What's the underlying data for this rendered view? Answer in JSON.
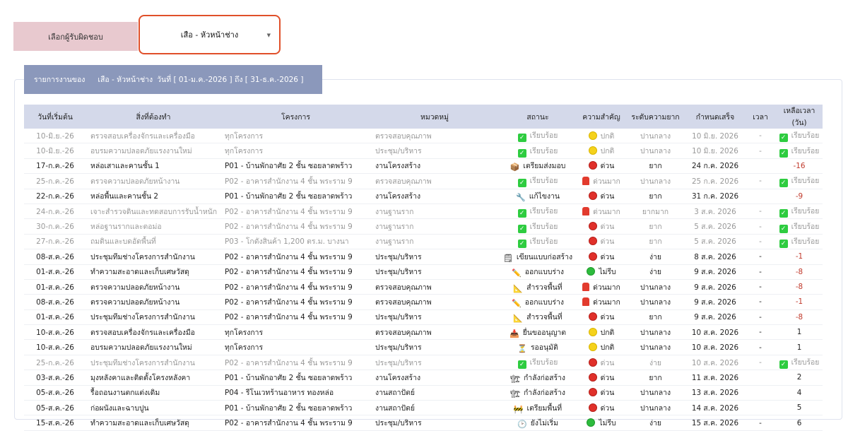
{
  "filter": {
    "label": "เลือกผู้รับผิดชอบ",
    "selected": "เสือ - หัวหน้าช่าง"
  },
  "report": {
    "prefix": "รายการงานของ",
    "person": "เสือ - หัวหน้าช่าง",
    "range": "วันที่ [ 01-ม.ค.-2026 ] ถึง [ 31-ธ.ค.-2026 ]"
  },
  "columns": [
    "วันที่เริ่มต้น",
    "สิ่งที่ต้องทำ",
    "โครงการ",
    "หมวดหมู่",
    "สถานะ",
    "ความสำคัญ",
    "ระดับความยาก",
    "กำหนดเสร็จ",
    "เวลา",
    "เหลือเวลา (วัน)"
  ],
  "rows": [
    {
      "done": true,
      "start": "10-มิ.ย.-26",
      "task": "ตรวจสอบเครื่องจักรและเครื่องมือ",
      "project": "ทุกโครงการ",
      "category": "ตรวจสอบคุณภาพ",
      "status_icon": "check",
      "status": "เรียบร้อย",
      "priority_icon": "dot-yellow",
      "priority": "ปกติ",
      "difficulty": "ปานกลาง",
      "due": "10 มิ.ย. 2026",
      "time": "-",
      "remain_icon": "check",
      "remain": "เรียบร้อย"
    },
    {
      "done": true,
      "start": "10-มิ.ย.-26",
      "task": "อบรมความปลอดภัยแรงงานใหม่",
      "project": "ทุกโครงการ",
      "category": "ประชุม/บริหาร",
      "status_icon": "check",
      "status": "เรียบร้อย",
      "priority_icon": "dot-yellow",
      "priority": "ปกติ",
      "difficulty": "ปานกลาง",
      "due": "10 มิ.ย. 2026",
      "time": "-",
      "remain_icon": "check",
      "remain": "เรียบร้อย"
    },
    {
      "done": false,
      "start": "17-ก.ค.-26",
      "task": "หล่อเสาและคานชั้น 1",
      "project": "P01 - บ้านพักอาศัย 2 ชั้น ซอยลาดพร้าว",
      "category": "งานโครงสร้าง",
      "status_icon": "box-icon",
      "status": "เตรียมส่งมอบ",
      "priority_icon": "dot-red",
      "priority": "ด่วน",
      "difficulty": "ยาก",
      "due": "24 ก.ค. 2026",
      "time": "",
      "remain_icon": "",
      "remain": "-16",
      "neg": true
    },
    {
      "done": true,
      "start": "25-ก.ค.-26",
      "task": "ตรวจความปลอดภัยหน้างาน",
      "project": "P02 - อาคารสำนักงาน 4 ชั้น พระราม 9",
      "category": "ตรวจสอบคุณภาพ",
      "status_icon": "check",
      "status": "เรียบร้อย",
      "priority_icon": "siren",
      "priority": "ด่วนมาก",
      "difficulty": "ปานกลาง",
      "due": "25 ก.ค. 2026",
      "time": "-",
      "remain_icon": "check",
      "remain": "เรียบร้อย"
    },
    {
      "done": false,
      "start": "22-ก.ค.-26",
      "task": "หล่อพื้นและคานชั้น 2",
      "project": "P01 - บ้านพักอาศัย 2 ชั้น ซอยลาดพร้าว",
      "category": "งานโครงสร้าง",
      "status_icon": "wrench-icon",
      "status": "แก้ไขงาน",
      "priority_icon": "dot-red",
      "priority": "ด่วน",
      "difficulty": "ยาก",
      "due": "31 ก.ค. 2026",
      "time": "",
      "remain_icon": "",
      "remain": "-9",
      "neg": true
    },
    {
      "done": true,
      "start": "24-ก.ค.-26",
      "task": "เจาะสำรวจดินและทดสอบการรับน้ำหนัก",
      "project": "P02 - อาคารสำนักงาน 4 ชั้น พระราม 9",
      "category": "งานฐานราก",
      "status_icon": "check",
      "status": "เรียบร้อย",
      "priority_icon": "siren",
      "priority": "ด่วนมาก",
      "difficulty": "ยากมาก",
      "due": "3 ส.ค. 2026",
      "time": "-",
      "remain_icon": "check",
      "remain": "เรียบร้อย"
    },
    {
      "done": true,
      "start": "30-ก.ค.-26",
      "task": "หล่อฐานรากและตอม่อ",
      "project": "P02 - อาคารสำนักงาน 4 ชั้น พระราม 9",
      "category": "งานฐานราก",
      "status_icon": "check",
      "status": "เรียบร้อย",
      "priority_icon": "dot-red",
      "priority": "ด่วน",
      "difficulty": "ยาก",
      "due": "5 ส.ค. 2026",
      "time": "-",
      "remain_icon": "check",
      "remain": "เรียบร้อย"
    },
    {
      "done": true,
      "start": "27-ก.ค.-26",
      "task": "ถมดินและบดอัดพื้นที่",
      "project": "P03 - โกดังสินค้า 1,200 ตร.ม. บางนา",
      "category": "งานฐานราก",
      "status_icon": "check",
      "status": "เรียบร้อย",
      "priority_icon": "dot-red",
      "priority": "ด่วน",
      "difficulty": "ยาก",
      "due": "5 ส.ค. 2026",
      "time": "-",
      "remain_icon": "check",
      "remain": "เรียบร้อย"
    },
    {
      "done": false,
      "start": "08-ส.ค.-26",
      "task": "ประชุมทีมช่างโครงการสำนักงาน",
      "project": "P02 - อาคารสำนักงาน 4 ชั้น พระราม 9",
      "category": "ประชุม/บริหาร",
      "status_icon": "notepad-icon",
      "status": "เขียนแบบก่อสร้าง",
      "priority_icon": "dot-red",
      "priority": "ด่วน",
      "difficulty": "ง่าย",
      "due": "8 ส.ค. 2026",
      "time": "-",
      "remain_icon": "",
      "remain": "-1",
      "neg": true
    },
    {
      "done": false,
      "start": "01-ส.ค.-26",
      "task": "ทำความสะอาดและเก็บเศษวัสดุ",
      "project": "P02 - อาคารสำนักงาน 4 ชั้น พระราม 9",
      "category": "ประชุม/บริหาร",
      "status_icon": "pencil-icon",
      "status": "ออกแบบร่าง",
      "priority_icon": "dot-green",
      "priority": "ไม่รีบ",
      "difficulty": "ง่าย",
      "due": "9 ส.ค. 2026",
      "time": "-",
      "remain_icon": "",
      "remain": "-8",
      "neg": true
    },
    {
      "done": false,
      "start": "01-ส.ค.-26",
      "task": "ตรวจความปลอดภัยหน้างาน",
      "project": "P02 - อาคารสำนักงาน 4 ชั้น พระราม 9",
      "category": "ตรวจสอบคุณภาพ",
      "status_icon": "ruler-icon",
      "status": "สำรวจพื้นที่",
      "priority_icon": "siren",
      "priority": "ด่วนมาก",
      "difficulty": "ปานกลาง",
      "due": "9 ส.ค. 2026",
      "time": "-",
      "remain_icon": "",
      "remain": "-8",
      "neg": true
    },
    {
      "done": false,
      "start": "08-ส.ค.-26",
      "task": "ตรวจความปลอดภัยหน้างาน",
      "project": "P02 - อาคารสำนักงาน 4 ชั้น พระราม 9",
      "category": "ตรวจสอบคุณภาพ",
      "status_icon": "pencil-icon",
      "status": "ออกแบบร่าง",
      "priority_icon": "siren",
      "priority": "ด่วนมาก",
      "difficulty": "ปานกลาง",
      "due": "9 ส.ค. 2026",
      "time": "-",
      "remain_icon": "",
      "remain": "-1",
      "neg": true
    },
    {
      "done": false,
      "start": "01-ส.ค.-26",
      "task": "ประชุมทีมช่างโครงการสำนักงาน",
      "project": "P02 - อาคารสำนักงาน 4 ชั้น พระราม 9",
      "category": "ประชุม/บริหาร",
      "status_icon": "ruler-icon",
      "status": "สำรวจพื้นที่",
      "priority_icon": "dot-red",
      "priority": "ด่วน",
      "difficulty": "ยาก",
      "due": "9 ส.ค. 2026",
      "time": "-",
      "remain_icon": "",
      "remain": "-8",
      "neg": true
    },
    {
      "done": false,
      "start": "10-ส.ค.-26",
      "task": "ตรวจสอบเครื่องจักรและเครื่องมือ",
      "project": "ทุกโครงการ",
      "category": "ตรวจสอบคุณภาพ",
      "status_icon": "inbox-icon",
      "status": "ยื่นขออนุญาต",
      "priority_icon": "dot-yellow",
      "priority": "ปกติ",
      "difficulty": "ปานกลาง",
      "due": "10 ส.ค. 2026",
      "time": "-",
      "remain_icon": "",
      "remain": "1"
    },
    {
      "done": false,
      "start": "10-ส.ค.-26",
      "task": "อบรมความปลอดภัยแรงงานใหม่",
      "project": "ทุกโครงการ",
      "category": "ประชุม/บริหาร",
      "status_icon": "hourglass-icon",
      "status": "รออนุมัติ",
      "priority_icon": "dot-yellow",
      "priority": "ปกติ",
      "difficulty": "ปานกลาง",
      "due": "10 ส.ค. 2026",
      "time": "-",
      "remain_icon": "",
      "remain": "1"
    },
    {
      "done": true,
      "start": "25-ก.ค.-26",
      "task": "ประชุมทีมช่างโครงการสำนักงาน",
      "project": "P02 - อาคารสำนักงาน 4 ชั้น พระราม 9",
      "category": "ประชุม/บริหาร",
      "status_icon": "check",
      "status": "เรียบร้อย",
      "priority_icon": "dot-red",
      "priority": "ด่วน",
      "difficulty": "ง่าย",
      "due": "10 ส.ค. 2026",
      "time": "-",
      "remain_icon": "check",
      "remain": "เรียบร้อย"
    },
    {
      "done": false,
      "start": "03-ส.ค.-26",
      "task": "มุงหลังคาและติดตั้งโครงหลังคา",
      "project": "P01 - บ้านพักอาศัย 2 ชั้น ซอยลาดพร้าว",
      "category": "งานโครงสร้าง",
      "status_icon": "crane-icon",
      "status": "กำลังก่อสร้าง",
      "priority_icon": "dot-red",
      "priority": "ด่วน",
      "difficulty": "ยาก",
      "due": "11 ส.ค. 2026",
      "time": "",
      "remain_icon": "",
      "remain": "2"
    },
    {
      "done": false,
      "start": "05-ส.ค.-26",
      "task": "รื้อถอนงานตกแต่งเดิม",
      "project": "P04 - รีโนเวทร้านอาหาร ทองหล่อ",
      "category": "งานสถาปัตย์",
      "status_icon": "crane-icon",
      "status": "กำลังก่อสร้าง",
      "priority_icon": "dot-red",
      "priority": "ด่วน",
      "difficulty": "ปานกลาง",
      "due": "13 ส.ค. 2026",
      "time": "",
      "remain_icon": "",
      "remain": "4"
    },
    {
      "done": false,
      "start": "05-ส.ค.-26",
      "task": "ก่อผนังและฉาบปูน",
      "project": "P01 - บ้านพักอาศัย 2 ชั้น ซอยลาดพร้าว",
      "category": "งานสถาปัตย์",
      "status_icon": "barrier-icon",
      "status": "เตรียมพื้นที่",
      "priority_icon": "dot-red",
      "priority": "ด่วน",
      "difficulty": "ปานกลาง",
      "due": "14 ส.ค. 2026",
      "time": "",
      "remain_icon": "",
      "remain": "5"
    },
    {
      "done": false,
      "start": "15-ส.ค.-26",
      "task": "ทำความสะอาดและเก็บเศษวัสดุ",
      "project": "P02 - อาคารสำนักงาน 4 ชั้น พระราม 9",
      "category": "ประชุม/บริหาร",
      "status_icon": "clock-icon",
      "status": "ยังไม่เริ่ม",
      "priority_icon": "dot-green",
      "priority": "ไม่รีบ",
      "difficulty": "ง่าย",
      "due": "15 ส.ค. 2026",
      "time": "-",
      "remain_icon": "",
      "remain": "6"
    }
  ]
}
